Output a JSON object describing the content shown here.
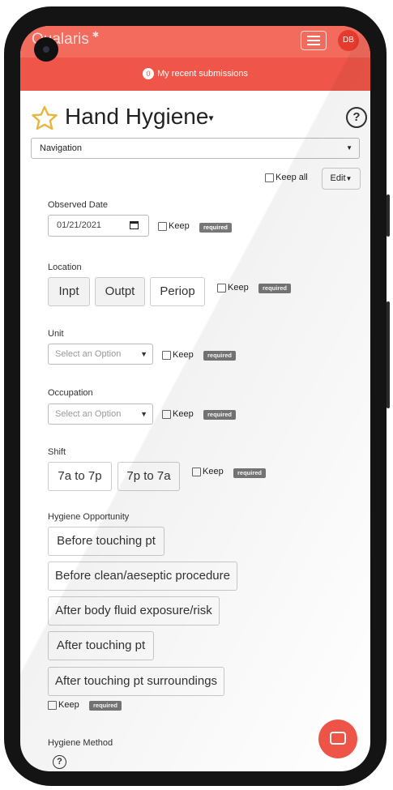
{
  "app": {
    "brand": "Qualaris",
    "brand_mark": "✱",
    "avatar_initials": "DB"
  },
  "header": {
    "submissions_count": "0",
    "submissions_label": "My recent submissions"
  },
  "form": {
    "title": "Hand Hygiene",
    "title_caret": "▾",
    "navigation_label": "Navigation",
    "keep_all_label": "Keep all",
    "edit_label": "Edit",
    "keep_label": "Keep",
    "required_label": "required",
    "observed_date": {
      "label": "Observed Date",
      "value": "01/21/2021"
    },
    "location": {
      "label": "Location",
      "options": [
        "Inpt",
        "Outpt",
        "Periop"
      ]
    },
    "unit": {
      "label": "Unit",
      "placeholder": "Select an Option"
    },
    "occupation": {
      "label": "Occupation",
      "placeholder": "Select an Option"
    },
    "shift": {
      "label": "Shift",
      "options": [
        "7a to 7p",
        "7p to 7a"
      ]
    },
    "hygiene_opportunity": {
      "label": "Hygiene Opportunity",
      "options": [
        "Before touching pt",
        "Before clean/aeseptic procedure",
        "After body fluid exposure/risk",
        "After touching pt",
        "After touching pt surroundings"
      ]
    },
    "hygiene_method": {
      "label": "Hygiene Method"
    }
  },
  "colors": {
    "brand_red": "#ef5548",
    "avatar_red": "#e53b2e",
    "star_gold": "#e7b63d",
    "required_gray": "#777777"
  },
  "icons": [
    "star-icon",
    "help-icon",
    "calendar-icon",
    "chat-icon",
    "hamburger-menu-icon",
    "camera-icon"
  ]
}
